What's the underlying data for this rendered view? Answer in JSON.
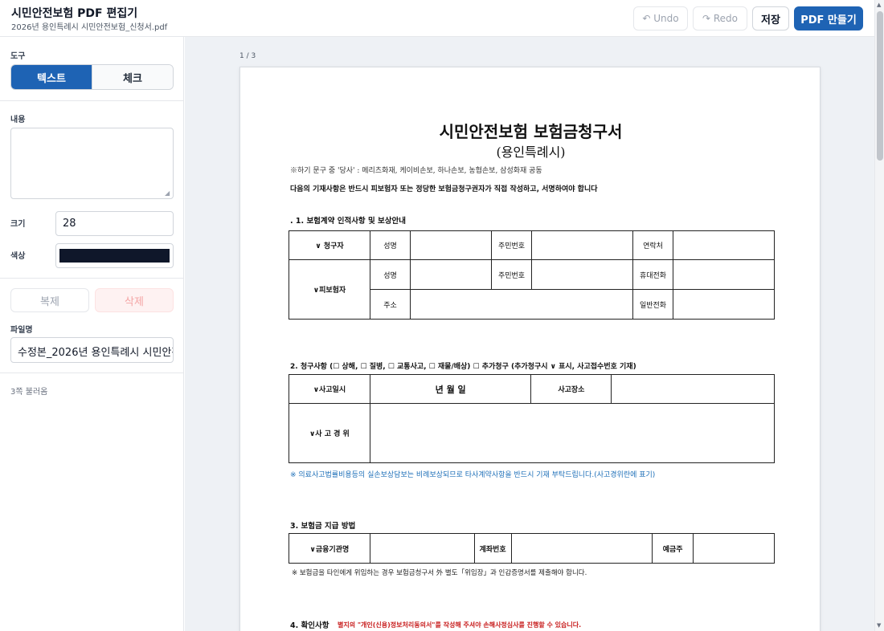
{
  "header": {
    "title": "시민안전보험 PDF 편집기",
    "filename": "2026년 용인특례시 시민안전보험_신청서.pdf",
    "undo": "↶ Undo",
    "redo": "↷ Redo",
    "save": "저장",
    "make_pdf": "PDF 만들기"
  },
  "sidebar": {
    "tools_label": "도구",
    "tool_text": "텍스트",
    "tool_check": "체크",
    "content_label": "내용",
    "content_value": "",
    "size_label": "크기",
    "size_value": "28",
    "color_label": "색상",
    "color_value": "#0f172a",
    "duplicate": "복제",
    "delete": "삭제",
    "filename_label": "파일명",
    "filename_value": "수정본_2026년 용인특례시 시민안전보험_신청서",
    "status": "3쪽 불러옴"
  },
  "viewer": {
    "page_indicator": "1 / 3"
  },
  "document": {
    "title": "시민안전보험 보험금청구서",
    "subtitle": "(용인특례시)",
    "note1": "※하기 문구 중 '당사' : 메리츠화재, 케이비손보, 하나손보, 농협손보, 삼성화재 공동",
    "note2": "다음의 기재사항은 반드시 피보험자 또는 정당한 보험금청구권자가 직접 작성하고, 서명하여야 합니다",
    "section1": ". 1. 보험계약 인적사항 및 보상안내",
    "t1": {
      "claimant": "∨ 청구자",
      "name": "성명",
      "rrn": "주민번호",
      "contact": "연락처",
      "insured": "∨피보험자",
      "mobile": "휴대전화",
      "address": "주소",
      "phone": "일반전화"
    },
    "section2": "2. 청구사항  (☐ 상해,  ☐ 질병,  ☐ 교통사고,  ☐ 재물/배상)      ☐ 추가청구 (추가청구시 ∨ 표시, 사고접수번호 기재)",
    "t2": {
      "date_label": "∨사고일시",
      "date_value": "년        월        일",
      "place": "사고장소",
      "details": "∨사 고 경 위"
    },
    "blue_note": "※ 의료사고법률비용등의 실손보상담보는 비례보상되므로 타사계약사항을 반드시 기재 부탁드립니다.(사고경위란에 표기)",
    "section3": "3. 보험금 지급 방법",
    "t3": {
      "bank": "∨금융기관명",
      "account": "계좌번호",
      "holder": "예금주"
    },
    "note3": "※ 보험금을 타인에게 위임하는 경우 보험금청구서 外 별도「위임장」과 인감증명서를 제출해야 합니다.",
    "section4": "4. 확인사항",
    "section4_red": "별지의 \"개인(신용)정보처리동의서\"를 작성해 주셔야 손해사정심사를 진행할 수 있습니다."
  }
}
